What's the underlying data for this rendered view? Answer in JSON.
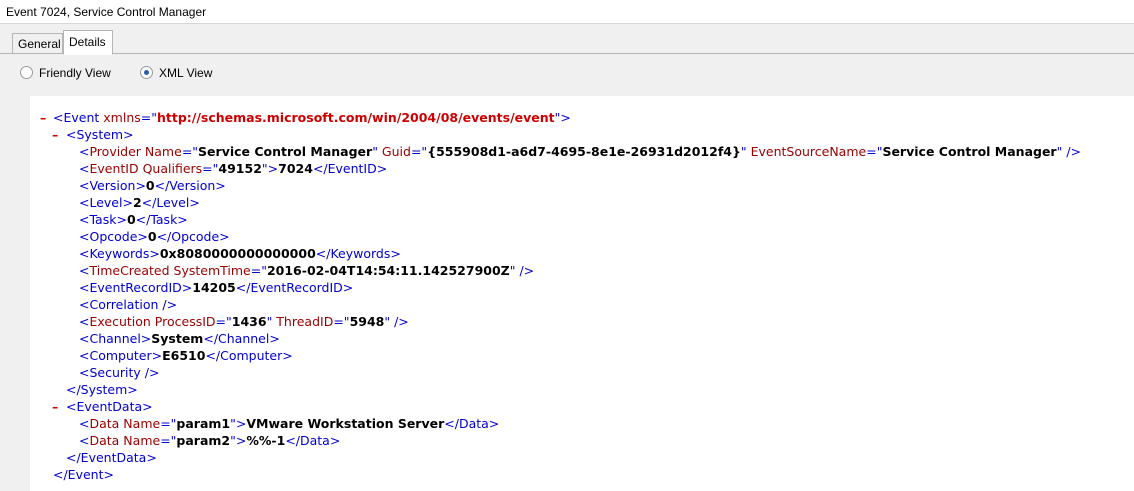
{
  "window": {
    "title": "Event 7024, Service Control Manager"
  },
  "tabs": [
    {
      "label": "General",
      "selected": false
    },
    {
      "label": "Details",
      "selected": true
    }
  ],
  "view_options": {
    "friendly": {
      "label": "Friendly View",
      "selected": false
    },
    "xml": {
      "label": "XML View",
      "selected": true
    }
  },
  "colors": {
    "tag": "#0000cc",
    "attribute_name": "#990000",
    "namespace_url": "#cc0000",
    "collapse_marker": "#cc0000",
    "selected_radio": "#2b5fa6"
  },
  "xml": {
    "collapse_marker": "–",
    "event_ns_attr": "xmlns",
    "event_ns": "http://schemas.microsoft.com/win/2004/08/events/event",
    "provider_name": "Service Control Manager",
    "provider_guid": "{555908d1-a6d7-4695-8e1e-26931d2012f4}",
    "event_source_name": "Service Control Manager",
    "event_id_qualifiers": "49152",
    "event_id": "7024",
    "version": "0",
    "level": "2",
    "task": "0",
    "opcode": "0",
    "keywords": "0x8080000000000000",
    "system_time": "2016-02-04T14:54:11.142527900Z",
    "event_record_id": "14205",
    "process_id": "1436",
    "thread_id": "5948",
    "channel": "System",
    "computer": "E6510",
    "data": [
      {
        "name": "param1",
        "value": "VMware Workstation Server"
      },
      {
        "name": "param2",
        "value": "%%-1"
      }
    ]
  }
}
